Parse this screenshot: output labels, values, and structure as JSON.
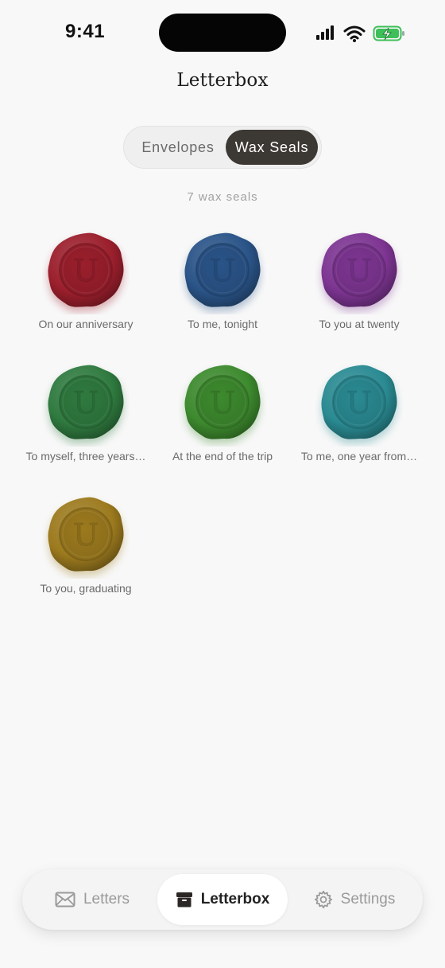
{
  "status_bar": {
    "time": "9:41"
  },
  "header": {
    "title": "Letterbox"
  },
  "segment": {
    "options": [
      "Envelopes",
      "Wax Seals"
    ],
    "selected": "Wax Seals"
  },
  "count_label": "7 wax seals",
  "seal_letter": "U",
  "seals": [
    {
      "label": "On our anniversary",
      "color": "#9b1f2c"
    },
    {
      "label": "To me, tonight",
      "color": "#2a5488"
    },
    {
      "label": "To you at twenty",
      "color": "#7d3592"
    },
    {
      "label": "To myself, three years…",
      "color": "#2f7a3f"
    },
    {
      "label": "At the end of the trip",
      "color": "#3d8a2e"
    },
    {
      "label": "To me, one year from…",
      "color": "#2a8a92"
    },
    {
      "label": "To you, graduating",
      "color": "#9c7a1e"
    }
  ],
  "tabbar": {
    "items": [
      {
        "label": "Letters",
        "icon": "envelope-icon"
      },
      {
        "label": "Letterbox",
        "icon": "archive-box-icon"
      },
      {
        "label": "Settings",
        "icon": "gear-icon"
      }
    ],
    "active": "Letterbox"
  },
  "colors": {
    "segment_active_bg": "#3c3833",
    "background": "#f8f8f8"
  }
}
